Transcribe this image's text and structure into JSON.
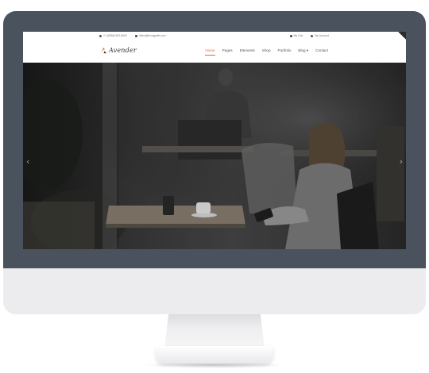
{
  "topbar": {
    "phone": "+1 (5556) 562-5603",
    "email": "office@foxuigrafh.com",
    "cart": "My Cart",
    "account": "My Account"
  },
  "brand": {
    "name": "Avender",
    "accent": "#e8692a"
  },
  "nav": {
    "items": [
      {
        "label": "Home",
        "active": true
      },
      {
        "label": "Pages"
      },
      {
        "label": "Elements"
      },
      {
        "label": "Shop"
      },
      {
        "label": "Portfolio"
      },
      {
        "label": "Blog ▾"
      },
      {
        "label": "Contact"
      }
    ]
  },
  "slider": {
    "prev_icon": "chevron-left-icon",
    "next_icon": "chevron-right-icon",
    "prev_glyph": "‹",
    "next_glyph": "›"
  }
}
